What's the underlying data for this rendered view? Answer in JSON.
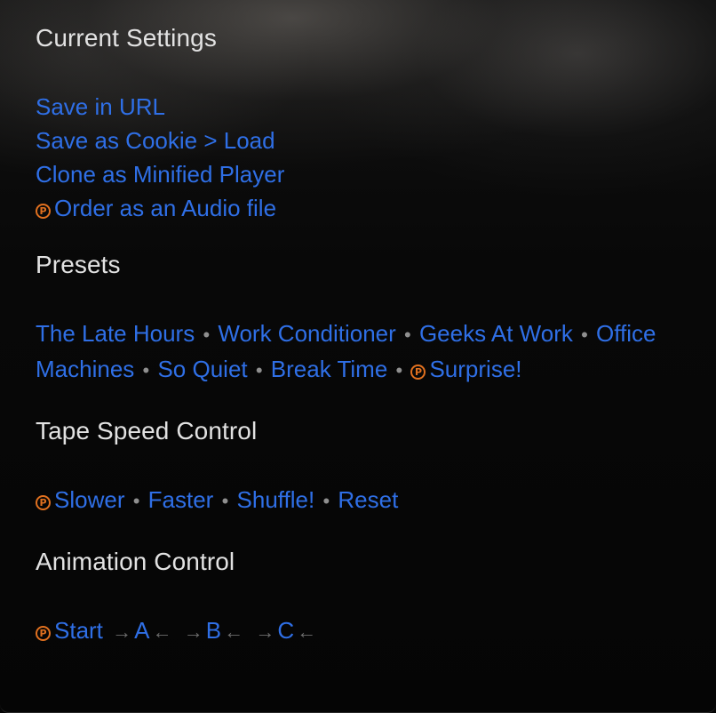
{
  "current_settings": {
    "heading": "Current Settings",
    "save_url": "Save in URL",
    "save_cookie": "Save as Cookie",
    "cookie_sep": ">",
    "load": "Load",
    "clone_minified": "Clone as Minified Player",
    "order_audio": "Order as an Audio file"
  },
  "presets": {
    "heading": "Presets",
    "items": [
      "The Late Hours",
      "Work Conditioner",
      "Geeks At Work",
      "Office Machines",
      "So Quiet",
      "Break Time",
      "Surprise!"
    ]
  },
  "tape_speed": {
    "heading": "Tape Speed Control",
    "items": [
      "Slower",
      "Faster",
      "Shuffle!",
      "Reset"
    ]
  },
  "animation": {
    "heading": "Animation Control",
    "start": "Start",
    "items": [
      "A",
      "B",
      "C"
    ]
  },
  "symbols": {
    "separator": "•",
    "premium": "P",
    "arrow_right": "→",
    "arrow_left": "←"
  },
  "colors": {
    "link": "#2f6fe6",
    "heading": "#e2e2e2",
    "premium": "#e0701f",
    "separator": "#8f8f8f"
  }
}
